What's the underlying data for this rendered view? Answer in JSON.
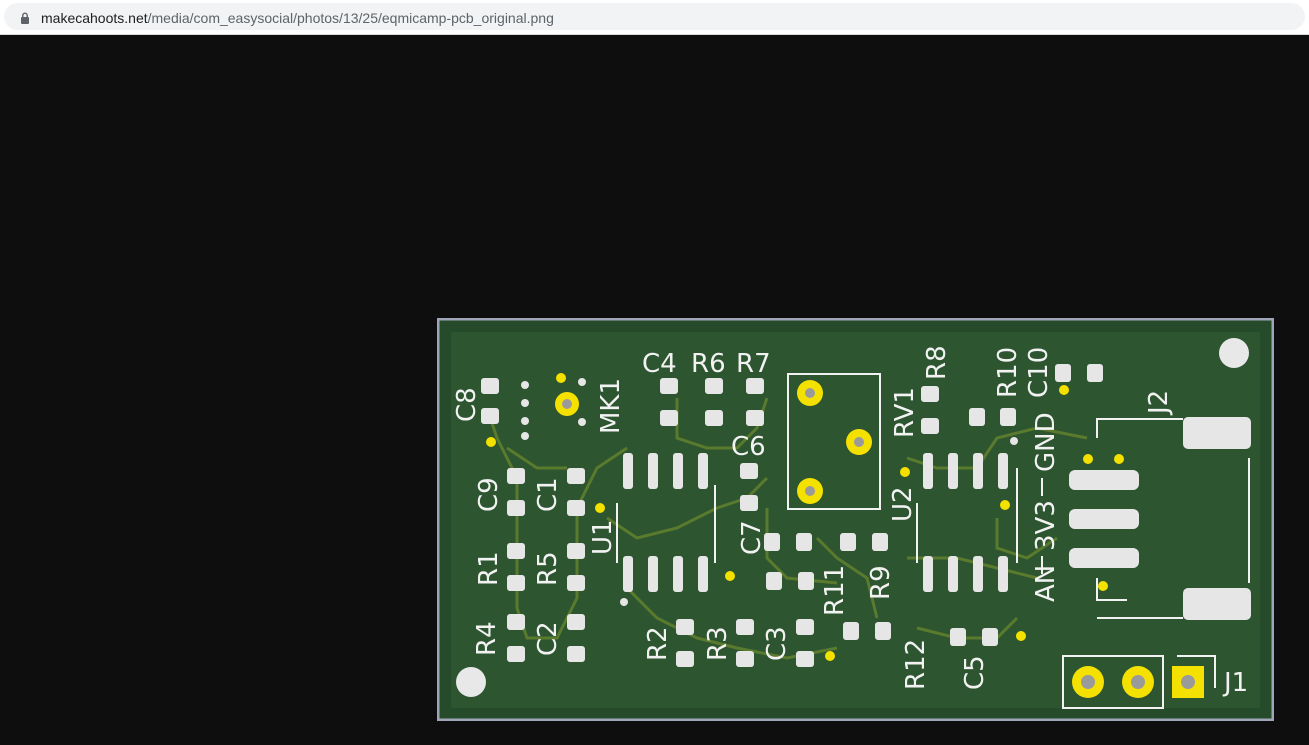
{
  "browser": {
    "url_host": "makecahoots.net",
    "url_path": "/media/com_easysocial/photos/13/25/eqmicamp-pcb_original.png",
    "lock_icon": "lock-icon"
  },
  "image": {
    "description_colors": {
      "board": "#264b2a",
      "trace": "#5a7a2e",
      "pad": "#e6e6e6",
      "silk": "#f2f2f2",
      "via": "#f5e100",
      "edge": "#a0a4b8"
    },
    "labels": {
      "C8": "C8",
      "MK1": "MK1",
      "C4": "C4",
      "R6": "R6",
      "R7": "R7",
      "R8": "R8",
      "R10": "R10",
      "C10": "C10",
      "RV1": "RV1",
      "J2": "J2",
      "C6": "C6",
      "C9": "C9",
      "C1": "C1",
      "U1": "U1",
      "C7": "C7",
      "U2": "U2",
      "GND": "GND",
      "V3V3": "3V3",
      "AN": "AN",
      "R1": "R1",
      "R5": "R5",
      "R11": "R11",
      "R9": "R9",
      "R4": "R4",
      "C2": "C2",
      "R2": "R2",
      "R3": "R3",
      "C3": "C3",
      "R12": "R12",
      "C5": "C5",
      "J1": "J1"
    }
  }
}
